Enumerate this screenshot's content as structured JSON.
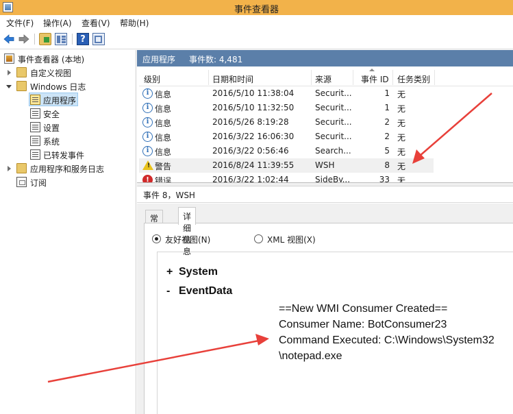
{
  "window": {
    "title": "事件查看器"
  },
  "menu": [
    "文件(F)",
    "操作(A)",
    "查看(V)",
    "帮助(H)"
  ],
  "toolbar": {
    "back": "back-icon",
    "forward": "forward-icon",
    "help_glyph": "?"
  },
  "tree": {
    "root": "事件查看器 (本地)",
    "custom_views": "自定义视图",
    "windows_logs": "Windows 日志",
    "logs": [
      "应用程序",
      "安全",
      "设置",
      "系统",
      "已转发事件"
    ],
    "app_service_logs": "应用程序和服务日志",
    "subscriptions": "订阅"
  },
  "list_header": {
    "title": "应用程序",
    "count": "事件数: 4,481"
  },
  "columns": [
    "级别",
    "日期和时间",
    "来源",
    "事件 ID",
    "任务类别"
  ],
  "events": [
    {
      "level": "信息",
      "icon": "info-icon",
      "datetime": "2016/5/10 11:38:04",
      "source": "Securit...",
      "id": "1",
      "category": "无"
    },
    {
      "level": "信息",
      "icon": "info-icon",
      "datetime": "2016/5/10 11:32:50",
      "source": "Securit...",
      "id": "1",
      "category": "无"
    },
    {
      "level": "信息",
      "icon": "info-icon",
      "datetime": "2016/5/26 8:19:28",
      "source": "Securit...",
      "id": "2",
      "category": "无"
    },
    {
      "level": "信息",
      "icon": "info-icon",
      "datetime": "2016/3/22 16:06:30",
      "source": "Securit...",
      "id": "2",
      "category": "无"
    },
    {
      "level": "信息",
      "icon": "info-icon",
      "datetime": "2016/3/22 0:56:46",
      "source": "Search...",
      "id": "5",
      "category": "无"
    },
    {
      "level": "警告",
      "icon": "warning-icon",
      "datetime": "2016/8/24 11:39:55",
      "source": "WSH",
      "id": "8",
      "category": "无"
    },
    {
      "level": "错误",
      "icon": "error-icon",
      "datetime": "2016/3/22 1:02:44",
      "source": "SideBy...",
      "id": "33",
      "category": "无"
    }
  ],
  "detail": {
    "title": "事件 8，WSH",
    "tabs": [
      "常规",
      "详细信息"
    ],
    "view_options": [
      "友好视图(N)",
      "XML 视图(X)"
    ],
    "nodes": [
      {
        "sign": "+",
        "label": "System"
      },
      {
        "sign": "-",
        "label": "EventData"
      }
    ],
    "event_data": [
      "==New WMI Consumer Created==",
      "Consumer Name: BotConsumer23",
      "Command Executed: C:\\Windows\\System32",
      "\\notepad.exe"
    ]
  },
  "colors": {
    "titlebar": "#f2b24a",
    "list_header_bg": "#5b7fa9",
    "selection": "#cce4f7",
    "annotation_arrow": "#e8403a"
  }
}
